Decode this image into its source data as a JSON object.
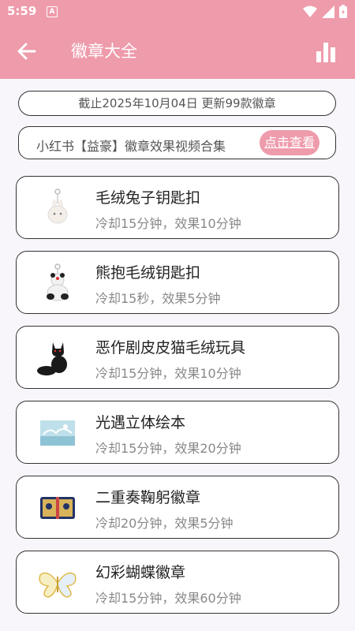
{
  "status_bar": {
    "time": "5:59",
    "notification_glyph": "A",
    "icons": [
      "wifi-icon",
      "signal-icon",
      "battery-icon"
    ]
  },
  "app_bar": {
    "title": "徽章大全",
    "back_icon": "arrow-left-icon",
    "stats_icon": "bar-chart-icon",
    "color": "#ee9bab"
  },
  "banner": {
    "text": "截止2025年10月04日 更新99款徽章"
  },
  "video_link": {
    "text": "小红书【益豪】徽章效果视频合集",
    "button_label": "点击查看"
  },
  "badges": [
    {
      "name": "毛绒兔子钥匙扣",
      "desc": "冷却15分钟，效果10分钟",
      "icon": "plush-bunny-keychain-icon"
    },
    {
      "name": "熊抱毛绒钥匙扣",
      "desc": "冷却15秒，效果5分钟",
      "icon": "panda-hug-keychain-icon"
    },
    {
      "name": "恶作剧皮皮猫毛绒玩具",
      "desc": "冷却15分钟，效果10分钟",
      "icon": "black-cat-plush-icon"
    },
    {
      "name": "光遇立体绘本",
      "desc": "冷却15分钟，效果20分钟",
      "icon": "popup-book-icon"
    },
    {
      "name": "二重奏鞠躬徽章",
      "desc": "冷却20分钟，效果5分钟",
      "icon": "duet-bow-badge-icon"
    },
    {
      "name": "幻彩蝴蝶徽章",
      "desc": "冷却15分钟，效果60分钟",
      "icon": "butterfly-badge-icon"
    }
  ]
}
